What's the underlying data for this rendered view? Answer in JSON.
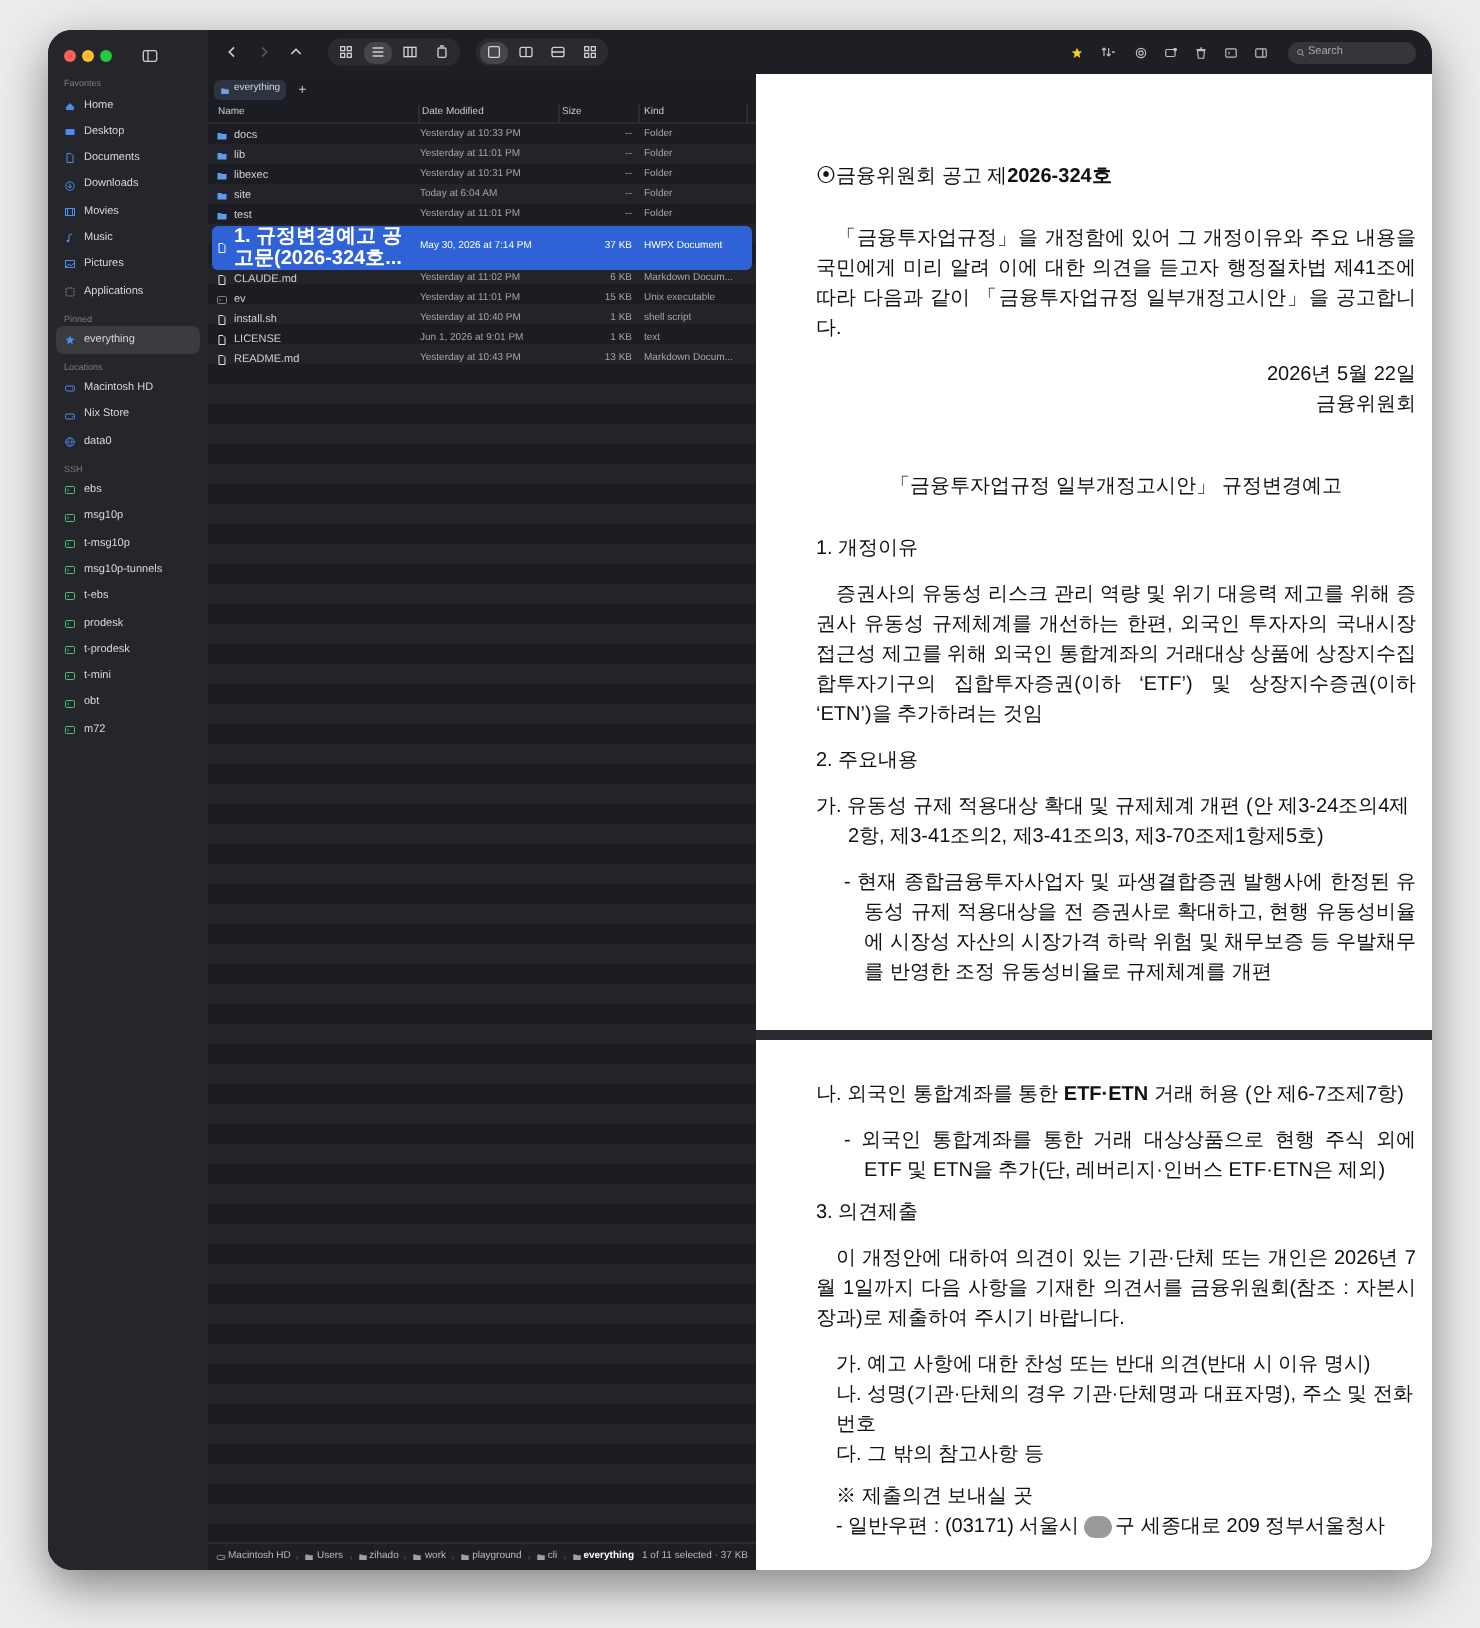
{
  "sidebar": {
    "sections": [
      {
        "title": "Favorites",
        "items": [
          {
            "label": "Home",
            "kind": "home",
            "selected": false
          },
          {
            "label": "Desktop",
            "kind": "desktop",
            "selected": false
          },
          {
            "label": "Documents",
            "kind": "doc",
            "selected": false
          },
          {
            "label": "Downloads",
            "kind": "download",
            "selected": false
          },
          {
            "label": "Movies",
            "kind": "film",
            "selected": false
          },
          {
            "label": "Music",
            "kind": "music",
            "selected": false
          },
          {
            "label": "Pictures",
            "kind": "picture",
            "selected": false
          },
          {
            "label": "Applications",
            "kind": "app",
            "selected": false
          }
        ]
      },
      {
        "title": "Pinned",
        "items": [
          {
            "label": "everything",
            "kind": "star",
            "selected": true
          }
        ]
      },
      {
        "title": "Locations",
        "items": [
          {
            "label": "Macintosh HD",
            "kind": "disk",
            "selected": false
          },
          {
            "label": "Nix Store",
            "kind": "disk",
            "selected": false
          },
          {
            "label": "data0",
            "kind": "globe",
            "selected": false
          }
        ]
      },
      {
        "title": "SSH",
        "items": [
          {
            "label": "ebs",
            "kind": "terminal",
            "selected": false
          },
          {
            "label": "msg10p",
            "kind": "terminal",
            "selected": false
          },
          {
            "label": "t-msg10p",
            "kind": "terminal",
            "selected": false
          },
          {
            "label": "msg10p-tunnels",
            "kind": "terminal",
            "selected": false
          },
          {
            "label": "t-ebs",
            "kind": "terminal",
            "selected": false
          },
          {
            "label": "prodesk",
            "kind": "terminal",
            "selected": false
          },
          {
            "label": "t-prodesk",
            "kind": "terminal",
            "selected": false
          },
          {
            "label": "t-mini",
            "kind": "terminal",
            "selected": false
          },
          {
            "label": "obt",
            "kind": "terminal",
            "selected": false
          },
          {
            "label": "m72",
            "kind": "terminal",
            "selected": false
          }
        ]
      }
    ]
  },
  "toolbar": {
    "view_modes": [
      {
        "kind": "icons",
        "selected": false
      },
      {
        "kind": "list",
        "selected": true
      },
      {
        "kind": "columns",
        "selected": false
      },
      {
        "kind": "gallery",
        "selected": false
      }
    ],
    "layout_modes": [
      {
        "kind": "single",
        "selected": true
      },
      {
        "kind": "split_v",
        "selected": false
      },
      {
        "kind": "split_h",
        "selected": false
      },
      {
        "kind": "quad",
        "selected": false
      }
    ],
    "search": {
      "placeholder": "Search"
    }
  },
  "tabs": [
    {
      "label": "everything",
      "selected": true
    }
  ],
  "new_tab": "+",
  "table": {
    "columns": [
      "Name",
      "Date Modified",
      "Size",
      "Kind"
    ],
    "rows": [
      {
        "name": "docs",
        "date": "Yesterday at 10:33 PM",
        "size": "--",
        "file_type": "Folder",
        "kind": "folder",
        "selected": false
      },
      {
        "name": "lib",
        "date": "Yesterday at 11:01 PM",
        "size": "--",
        "file_type": "Folder",
        "kind": "folder",
        "selected": false
      },
      {
        "name": "libexec",
        "date": "Yesterday at 10:31 PM",
        "size": "--",
        "file_type": "Folder",
        "kind": "folder",
        "selected": false
      },
      {
        "name": "site",
        "date": "Today at 6:04 AM",
        "size": "--",
        "file_type": "Folder",
        "kind": "folder",
        "selected": false
      },
      {
        "name": "test",
        "date": "Yesterday at 11:01 PM",
        "size": "--",
        "file_type": "Folder",
        "kind": "folder",
        "selected": false
      },
      {
        "name": "1. 규정변경예고 공고문(2026-324호...",
        "date": "May 30, 2026 at 7:14 PM",
        "size": "37 KB",
        "file_type": "HWPX Document",
        "kind": "file",
        "selected": true
      },
      {
        "name": "CLAUDE.md",
        "date": "Yesterday at 11:02 PM",
        "size": "6 KB",
        "file_type": "Markdown Docum...",
        "kind": "file",
        "selected": false
      },
      {
        "name": "ev",
        "date": "Yesterday at 11:01 PM",
        "size": "15 KB",
        "file_type": "Unix executable",
        "kind": "exec",
        "selected": false
      },
      {
        "name": "install.sh",
        "date": "Yesterday at 10:40 PM",
        "size": "1 KB",
        "file_type": "shell script",
        "kind": "file",
        "selected": false
      },
      {
        "name": "LICENSE",
        "date": "Jun 1, 2026 at 9:01 PM",
        "size": "1 KB",
        "file_type": "text",
        "kind": "file",
        "selected": false
      },
      {
        "name": "README.md",
        "date": "Yesterday at 10:43 PM",
        "size": "13 KB",
        "file_type": "Markdown Docum...",
        "kind": "file",
        "selected": false
      }
    ]
  },
  "path_bar": {
    "items": [
      {
        "label": "Macintosh HD",
        "kind": "disk"
      },
      {
        "label": "Users",
        "kind": "folder"
      },
      {
        "label": "zihado",
        "kind": "folder"
      },
      {
        "label": "work",
        "kind": "folder"
      },
      {
        "label": "playground",
        "kind": "folder"
      },
      {
        "label": "cli",
        "kind": "folder"
      },
      {
        "label": "everything",
        "kind": "folder"
      }
    ],
    "status": "1 of 11 selected · 37 KB"
  },
  "preview": {
    "pages": [
      {
        "blocks": [
          {
            "kind": "notice",
            "text": "⦿금융위원회 공고 제**2026-324호**"
          },
          {
            "kind": "para",
            "text": "「금융투자업규정」을 개정함에 있어 그 개정이유와 주요 내용을 국민에게 미리 알려 이에 대한 의견을 듣고자 행정절차법 제41조에 따라 다음과 같이 「금융투자업규정 일부개정고시안」을 공고합니다."
          },
          {
            "kind": "right",
            "text": "2026년 5월 22일"
          },
          {
            "kind": "right",
            "text": "금융위원회"
          },
          {
            "kind": "center",
            "text": "「금융투자업규정 일부개정고시안」 규정변경예고"
          },
          {
            "kind": "section",
            "text": "1. 개정이유"
          },
          {
            "kind": "para",
            "text": "증권사의 유동성 리스크 관리 역량 및 위기 대응력 제고를 위해 증권사 유동성 규제체계를 개선하는 한편, 외국인 투자자의 국내시장 접근성 제고를 위해 외국인 통합계좌의 거래대상 상품에 상장지수집합투자기구의 집합투자증권(이하 ‘ETF’) 및 상장지수증권(이하 ‘ETN’)을 추가하려는 것임"
          },
          {
            "kind": "section",
            "text": "2. 주요내용"
          },
          {
            "kind": "item",
            "text": "가. 유동성 규제 적용대상 확대 및 규제체계 개편 (안 제3-24조의4제2항, 제3-41조의2, 제3-41조의3, 제3-70조제1항제5호)"
          },
          {
            "kind": "dash",
            "text": "- 현재 종합금융투자사업자 및 파생결합증권 발행사에 한정된 유동성 규제 적용대상을 전 증권사로 확대하고, 현행 유동성비율에 시장성 자산의 시장가격 하락 위험 및 채무보증 등 우발채무를 반영한 조정 유동성비율로 규제체계를 개편"
          }
        ]
      },
      {
        "blocks": [
          {
            "kind": "item",
            "text": "나. 외국인 통합계좌를 통한 **ETF·ETN** 거래 허용 (안 제6-7조제7항)"
          },
          {
            "kind": "dash",
            "text": "- 외국인 통합계좌를 통한 거래 대상상품으로 현행 주식 외에 ETF 및 ETN을 추가(단, 레버리지·인버스 ETF·ETN은 제외)"
          },
          {
            "kind": "section",
            "text": "3. 의견제출"
          },
          {
            "kind": "para",
            "text": "이 개정안에 대하여 의견이 있는 기관·단체 또는 개인은 2026년 7월 1일까지 다음 사항을 기재한 의견서를 금융위원회(참조 : 자본시장과)로 제출하여 주시기 바랍니다."
          },
          {
            "kind": "list",
            "text": "가. 예고 사항에 대한 찬성 또는 반대 의견(반대 시 이유 명시)"
          },
          {
            "kind": "list",
            "text": "나. 성명(기관·단체의 경우 기관·단체명과 대표자명), 주소 및 전화번호"
          },
          {
            "kind": "list",
            "text": "다. 그 밖의 참고사항 등"
          },
          {
            "kind": "note",
            "text": "※ 제출의견 보내실 곳"
          },
          {
            "kind": "address",
            "before": "- 일반우편 : (03171) 서울시",
            "after": "구 세종대로 209 정부서울청사"
          }
        ]
      }
    ]
  }
}
